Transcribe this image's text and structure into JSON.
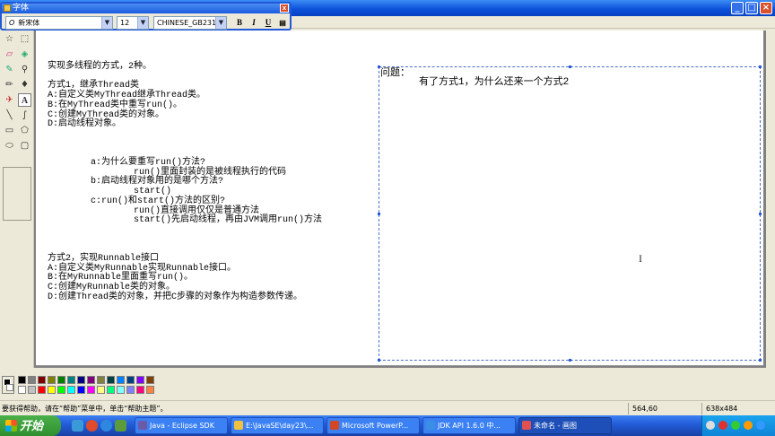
{
  "font_toolbar": {
    "title": "字体",
    "font_name": "新宋体",
    "font_size": "12",
    "charset": "CHINESE_GB2312",
    "bold": "B",
    "italic": "I",
    "underline": "U",
    "close": "x"
  },
  "window_buttons": {
    "minimize": "_",
    "maximize": "□",
    "close": "×"
  },
  "canvas": {
    "left_text": [
      "实现多线程的方式，2种。",
      "",
      "方式1，继承Thread类",
      "A:自定义类MyThread继承Thread类。",
      "B:在MyThread类中重写run()。",
      "C:创建MyThread类的对象。",
      "D:启动线程对象。",
      "",
      "",
      "",
      "        a:为什么要重写run()方法?",
      "                run()里面封装的是被线程执行的代码",
      "        b:启动线程对象用的是哪个方法?",
      "                start()",
      "        c:run()和start()方法的区别?",
      "                run()直接调用仅仅是普通方法",
      "                start()先启动线程，再由JVM调用run()方法",
      "",
      "",
      "",
      "方式2，实现Runnable接口",
      "A:自定义类MyRunnable实现Runnable接口。",
      "B:在MyRunnable里面重写run()。",
      "C:创建MyRunnable类的对象。",
      "D:创建Thread类的对象，并把C步骤的对象作为构造参数传递。"
    ],
    "textbox_title": "问题：",
    "textbox_body": "有了方式1，为什么还来一个方式2"
  },
  "palette": {
    "colors": [
      "#000000",
      "#808080",
      "#800000",
      "#808000",
      "#008000",
      "#008080",
      "#000080",
      "#800080",
      "#808040",
      "#004040",
      "#0080ff",
      "#004080",
      "#8000ff",
      "#804000",
      "#ffffff",
      "#c0c0c0",
      "#ff0000",
      "#ffff00",
      "#00ff00",
      "#00ffff",
      "#0000ff",
      "#ff00ff",
      "#ffff80",
      "#00ff80",
      "#80ffff",
      "#8080ff",
      "#ff0080",
      "#ff8040"
    ]
  },
  "statusbar": {
    "help_text": "要获得帮助，请在“帮助”菜单中，单击“帮助主题”。",
    "coords": "564,60",
    "size": "638x484"
  },
  "taskbar": {
    "start_label": "开始",
    "tasks": [
      {
        "label": "Java - Eclipse SDK",
        "icon_color": "#6b5aa8"
      },
      {
        "label": "E:\\JavaSE\\day23\\...",
        "icon_color": "#f0c040"
      },
      {
        "label": "Microsoft PowerP...",
        "icon_color": "#d24726"
      },
      {
        "label": "JDK API 1.6.0 中...",
        "icon_color": "#3a8ee6"
      },
      {
        "label": "未命名 - 画图",
        "icon_color": "#e05050"
      }
    ]
  }
}
